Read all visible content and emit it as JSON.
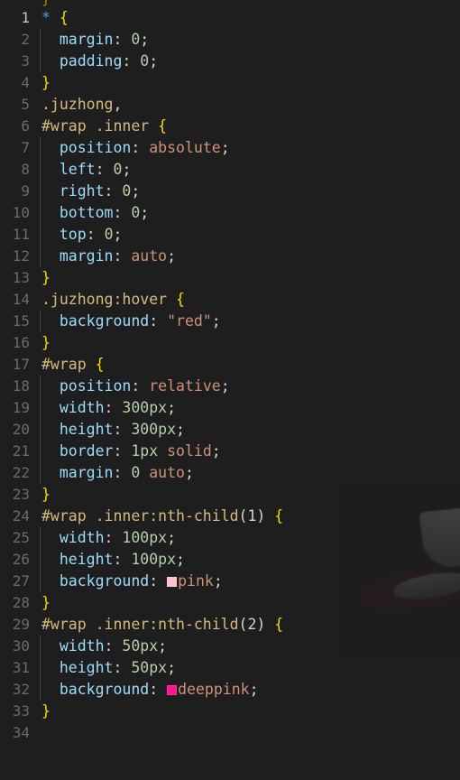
{
  "editor": {
    "language": "css",
    "theme_background": "#1e1e1e",
    "active_line": 1,
    "total_lines": 34,
    "gutter_color": "#6b6b6b",
    "gutter_active_color": "#c6c6c6",
    "token_colors": {
      "selector": "#d7ba7d",
      "property": "#9cdcfe",
      "value": "#ce9178",
      "number": "#b5cea8",
      "brace": "#ffd700",
      "punctuation": "#d4d4d4",
      "universal": "#569cd6"
    },
    "partial_top_line": {
      "text": "}",
      "visible": true
    },
    "color_swatches": [
      {
        "line": 27,
        "name": "pink",
        "hex": "#FFC0CB"
      },
      {
        "line": 32,
        "name": "deeppink",
        "hex": "#FF1493"
      }
    ],
    "lines": [
      {
        "n": "1",
        "indent": 0,
        "guide": false,
        "tokens": [
          {
            "t": "*",
            "c": "star"
          },
          {
            "t": " ",
            "c": "punc"
          },
          {
            "t": "{",
            "c": "brace"
          }
        ]
      },
      {
        "n": "2",
        "indent": 1,
        "guide": true,
        "tokens": [
          {
            "t": "margin",
            "c": "prop"
          },
          {
            "t": ": ",
            "c": "punc"
          },
          {
            "t": "0",
            "c": "num"
          },
          {
            "t": ";",
            "c": "punc"
          }
        ]
      },
      {
        "n": "3",
        "indent": 1,
        "guide": true,
        "tokens": [
          {
            "t": "padding",
            "c": "prop"
          },
          {
            "t": ": ",
            "c": "punc"
          },
          {
            "t": "0",
            "c": "num"
          },
          {
            "t": ";",
            "c": "punc"
          }
        ]
      },
      {
        "n": "4",
        "indent": 0,
        "guide": false,
        "tokens": [
          {
            "t": "}",
            "c": "brace"
          }
        ]
      },
      {
        "n": "5",
        "indent": 0,
        "guide": false,
        "tokens": [
          {
            "t": ".juzhong",
            "c": "sel"
          },
          {
            "t": ",",
            "c": "punc"
          }
        ]
      },
      {
        "n": "6",
        "indent": 0,
        "guide": false,
        "tokens": [
          {
            "t": "#wrap .inner",
            "c": "sel"
          },
          {
            "t": " ",
            "c": "punc"
          },
          {
            "t": "{",
            "c": "brace"
          }
        ]
      },
      {
        "n": "7",
        "indent": 1,
        "guide": true,
        "tokens": [
          {
            "t": "position",
            "c": "prop"
          },
          {
            "t": ": ",
            "c": "punc"
          },
          {
            "t": "absolute",
            "c": "val"
          },
          {
            "t": ";",
            "c": "punc"
          }
        ]
      },
      {
        "n": "8",
        "indent": 1,
        "guide": true,
        "tokens": [
          {
            "t": "left",
            "c": "prop"
          },
          {
            "t": ": ",
            "c": "punc"
          },
          {
            "t": "0",
            "c": "num"
          },
          {
            "t": ";",
            "c": "punc"
          }
        ]
      },
      {
        "n": "9",
        "indent": 1,
        "guide": true,
        "tokens": [
          {
            "t": "right",
            "c": "prop"
          },
          {
            "t": ": ",
            "c": "punc"
          },
          {
            "t": "0",
            "c": "num"
          },
          {
            "t": ";",
            "c": "punc"
          }
        ]
      },
      {
        "n": "10",
        "indent": 1,
        "guide": true,
        "tokens": [
          {
            "t": "bottom",
            "c": "prop"
          },
          {
            "t": ": ",
            "c": "punc"
          },
          {
            "t": "0",
            "c": "num"
          },
          {
            "t": ";",
            "c": "punc"
          }
        ]
      },
      {
        "n": "11",
        "indent": 1,
        "guide": true,
        "tokens": [
          {
            "t": "top",
            "c": "prop"
          },
          {
            "t": ": ",
            "c": "punc"
          },
          {
            "t": "0",
            "c": "num"
          },
          {
            "t": ";",
            "c": "punc"
          }
        ]
      },
      {
        "n": "12",
        "indent": 1,
        "guide": true,
        "tokens": [
          {
            "t": "margin",
            "c": "prop"
          },
          {
            "t": ": ",
            "c": "punc"
          },
          {
            "t": "auto",
            "c": "val"
          },
          {
            "t": ";",
            "c": "punc"
          }
        ]
      },
      {
        "n": "13",
        "indent": 0,
        "guide": false,
        "tokens": [
          {
            "t": "}",
            "c": "brace"
          }
        ]
      },
      {
        "n": "14",
        "indent": 0,
        "guide": false,
        "tokens": [
          {
            "t": ".juzhong:hover",
            "c": "sel"
          },
          {
            "t": " ",
            "c": "punc"
          },
          {
            "t": "{",
            "c": "brace"
          }
        ]
      },
      {
        "n": "15",
        "indent": 1,
        "guide": true,
        "tokens": [
          {
            "t": "background",
            "c": "prop"
          },
          {
            "t": ": ",
            "c": "punc"
          },
          {
            "t": "\"red\"",
            "c": "val"
          },
          {
            "t": ";",
            "c": "punc"
          }
        ]
      },
      {
        "n": "16",
        "indent": 0,
        "guide": false,
        "tokens": [
          {
            "t": "}",
            "c": "brace"
          }
        ]
      },
      {
        "n": "17",
        "indent": 0,
        "guide": false,
        "tokens": [
          {
            "t": "#wrap",
            "c": "sel"
          },
          {
            "t": " ",
            "c": "punc"
          },
          {
            "t": "{",
            "c": "brace"
          }
        ]
      },
      {
        "n": "18",
        "indent": 1,
        "guide": true,
        "tokens": [
          {
            "t": "position",
            "c": "prop"
          },
          {
            "t": ": ",
            "c": "punc"
          },
          {
            "t": "relative",
            "c": "val"
          },
          {
            "t": ";",
            "c": "punc"
          }
        ]
      },
      {
        "n": "19",
        "indent": 1,
        "guide": true,
        "tokens": [
          {
            "t": "width",
            "c": "prop"
          },
          {
            "t": ": ",
            "c": "punc"
          },
          {
            "t": "300px",
            "c": "num"
          },
          {
            "t": ";",
            "c": "punc"
          }
        ]
      },
      {
        "n": "20",
        "indent": 1,
        "guide": true,
        "tokens": [
          {
            "t": "height",
            "c": "prop"
          },
          {
            "t": ": ",
            "c": "punc"
          },
          {
            "t": "300px",
            "c": "num"
          },
          {
            "t": ";",
            "c": "punc"
          }
        ]
      },
      {
        "n": "21",
        "indent": 1,
        "guide": true,
        "tokens": [
          {
            "t": "border",
            "c": "prop"
          },
          {
            "t": ": ",
            "c": "punc"
          },
          {
            "t": "1px",
            "c": "num"
          },
          {
            "t": " ",
            "c": "punc"
          },
          {
            "t": "solid",
            "c": "val"
          },
          {
            "t": ";",
            "c": "punc"
          }
        ]
      },
      {
        "n": "22",
        "indent": 1,
        "guide": true,
        "tokens": [
          {
            "t": "margin",
            "c": "prop"
          },
          {
            "t": ": ",
            "c": "punc"
          },
          {
            "t": "0",
            "c": "num"
          },
          {
            "t": " ",
            "c": "punc"
          },
          {
            "t": "auto",
            "c": "val"
          },
          {
            "t": ";",
            "c": "punc"
          }
        ]
      },
      {
        "n": "23",
        "indent": 0,
        "guide": false,
        "tokens": [
          {
            "t": "}",
            "c": "brace"
          }
        ]
      },
      {
        "n": "24",
        "indent": 0,
        "guide": false,
        "tokens": [
          {
            "t": "#wrap .inner:nth-child",
            "c": "sel"
          },
          {
            "t": "(1) ",
            "c": "punc"
          },
          {
            "t": "{",
            "c": "brace"
          }
        ]
      },
      {
        "n": "25",
        "indent": 1,
        "guide": true,
        "tokens": [
          {
            "t": "width",
            "c": "prop"
          },
          {
            "t": ": ",
            "c": "punc"
          },
          {
            "t": "100px",
            "c": "num"
          },
          {
            "t": ";",
            "c": "punc"
          }
        ]
      },
      {
        "n": "26",
        "indent": 1,
        "guide": true,
        "tokens": [
          {
            "t": "height",
            "c": "prop"
          },
          {
            "t": ": ",
            "c": "punc"
          },
          {
            "t": "100px",
            "c": "num"
          },
          {
            "t": ";",
            "c": "punc"
          }
        ]
      },
      {
        "n": "27",
        "indent": 1,
        "guide": true,
        "swatch": "#FFC0CB",
        "tokens": [
          {
            "t": "background",
            "c": "prop"
          },
          {
            "t": ": ",
            "c": "punc"
          },
          {
            "t": "pink",
            "c": "val"
          },
          {
            "t": ";",
            "c": "punc"
          }
        ]
      },
      {
        "n": "28",
        "indent": 0,
        "guide": false,
        "tokens": [
          {
            "t": "}",
            "c": "brace"
          }
        ]
      },
      {
        "n": "29",
        "indent": 0,
        "guide": false,
        "tokens": [
          {
            "t": "#wrap .inner:nth-child",
            "c": "sel"
          },
          {
            "t": "(2) ",
            "c": "punc"
          },
          {
            "t": "{",
            "c": "brace"
          }
        ]
      },
      {
        "n": "30",
        "indent": 1,
        "guide": true,
        "tokens": [
          {
            "t": "width",
            "c": "prop"
          },
          {
            "t": ": ",
            "c": "punc"
          },
          {
            "t": "50px",
            "c": "num"
          },
          {
            "t": ";",
            "c": "punc"
          }
        ]
      },
      {
        "n": "31",
        "indent": 1,
        "guide": true,
        "tokens": [
          {
            "t": "height",
            "c": "prop"
          },
          {
            "t": ": ",
            "c": "punc"
          },
          {
            "t": "50px",
            "c": "num"
          },
          {
            "t": ";",
            "c": "punc"
          }
        ]
      },
      {
        "n": "32",
        "indent": 1,
        "guide": true,
        "swatch": "#FF1493",
        "tokens": [
          {
            "t": "background",
            "c": "prop"
          },
          {
            "t": ": ",
            "c": "punc"
          },
          {
            "t": "deeppink",
            "c": "val"
          },
          {
            "t": ";",
            "c": "punc"
          }
        ]
      },
      {
        "n": "33",
        "indent": 0,
        "guide": false,
        "tokens": [
          {
            "t": "}",
            "c": "brace"
          }
        ]
      },
      {
        "n": "34",
        "indent": 0,
        "guide": false,
        "tokens": []
      }
    ]
  }
}
